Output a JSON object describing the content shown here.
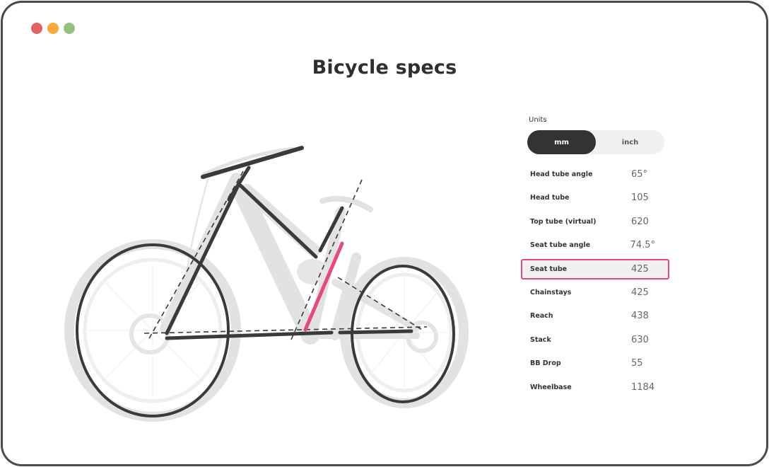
{
  "window": {
    "controls": [
      "close",
      "minimize",
      "maximize"
    ]
  },
  "page": {
    "title": "Bicycle specs"
  },
  "units": {
    "label": "Units",
    "options": [
      "mm",
      "inch"
    ],
    "selected": "mm"
  },
  "specs": [
    {
      "label": "Head tube angle",
      "value": "65°"
    },
    {
      "label": "Head tube",
      "value": "105"
    },
    {
      "label": "Top tube (virtual)",
      "value": "620"
    },
    {
      "label": "Seat tube angle",
      "value": "74.5°"
    },
    {
      "label": "Seat tube",
      "value": "425",
      "active": true
    },
    {
      "label": "Chainstays",
      "value": "425"
    },
    {
      "label": "Reach",
      "value": "438"
    },
    {
      "label": "Stack",
      "value": "630"
    },
    {
      "label": "BB Drop",
      "value": "55"
    },
    {
      "label": "Wheelbase",
      "value": "1184"
    }
  ],
  "colors": {
    "highlight": "#e8497a",
    "geometry_line": "#3a3a3a",
    "bike_silhouette": "#dcdcdc"
  }
}
